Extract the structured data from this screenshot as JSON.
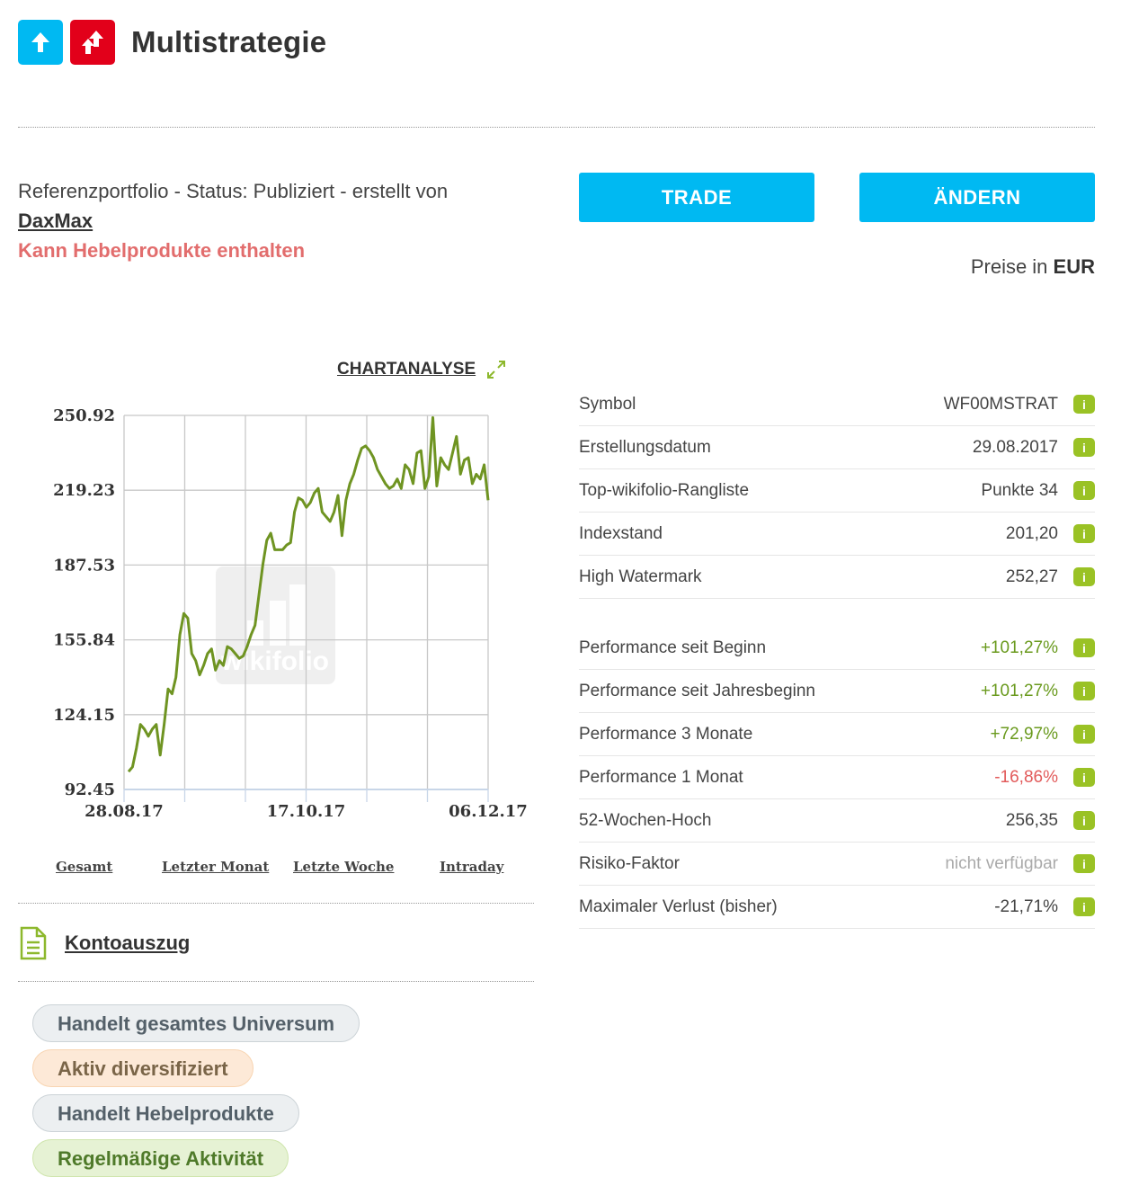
{
  "header": {
    "title": "Multistrategie",
    "badges": [
      {
        "icon": "arrow-up-icon",
        "color": "#00b9f2"
      },
      {
        "icon": "double-arrow-up-icon",
        "color": "#e2001a"
      }
    ]
  },
  "meta": {
    "status_line": "Referenzportfolio - Status: Publiziert - erstellt von",
    "author": "DaxMax",
    "leverage_warning": "Kann Hebelprodukte enthalten"
  },
  "actions": {
    "trade_label": "TRADE",
    "edit_label": "ÄNDERN"
  },
  "prices": {
    "prefix": "Preise in",
    "currency": "EUR"
  },
  "chart_link": {
    "label": "CHARTANALYSE"
  },
  "chart_data": {
    "type": "line",
    "title": "",
    "xlabel": "",
    "ylabel": "",
    "y_ticks": [
      "250.92",
      "219.23",
      "187.53",
      "155.84",
      "124.15",
      "92.45"
    ],
    "x_ticks": [
      "28.08.17",
      "17.10.17",
      "06.12.17"
    ],
    "ylim": [
      92.45,
      250.92
    ],
    "grid": true,
    "color": "#6f9422",
    "watermark": "wikifolio",
    "series": [
      {
        "values": [
          100,
          102,
          110,
          120,
          118,
          115,
          118,
          120,
          107,
          120,
          135,
          133,
          140,
          158,
          167,
          165,
          150,
          147,
          141,
          145,
          150,
          152,
          143,
          147,
          145,
          153,
          152,
          150,
          148,
          149,
          153,
          158,
          162,
          175,
          188,
          198,
          201,
          194,
          194,
          194,
          196,
          197,
          210,
          216,
          215,
          212,
          214,
          218,
          220,
          210,
          208,
          206,
          210,
          217,
          200,
          215,
          222,
          226,
          232,
          237,
          238,
          236,
          233,
          228,
          225,
          222,
          220,
          221,
          224,
          220,
          230,
          228,
          222,
          235,
          236,
          220,
          225,
          250,
          221,
          233,
          230,
          228,
          235,
          242,
          226,
          232,
          233,
          222,
          226,
          224,
          230,
          215
        ]
      }
    ]
  },
  "range_links": [
    "Gesamt",
    "Letzter Monat",
    "Letzte Woche",
    "Intraday"
  ],
  "statement": {
    "label": "Kontoauszug",
    "icon": "document-icon"
  },
  "tags": [
    {
      "label": "Handelt gesamtes Universum",
      "style": "grey"
    },
    {
      "label": "Aktiv diversifiziert",
      "style": "orange"
    },
    {
      "label": "Handelt Hebelprodukte",
      "style": "grey"
    },
    {
      "label": "Regelmäßige Aktivität",
      "style": "green"
    }
  ],
  "key_facts": [
    {
      "label": "Symbol",
      "value": "WF00MSTRAT",
      "tone": "normal"
    },
    {
      "label": "Erstellungsdatum",
      "value": "29.08.2017",
      "tone": "normal"
    },
    {
      "label": "Top-wikifolio-Rangliste",
      "value": "Punkte 34",
      "tone": "normal"
    },
    {
      "label": "Indexstand",
      "value": "201,20",
      "tone": "normal"
    },
    {
      "label": "High Watermark",
      "value": "252,27",
      "tone": "normal"
    }
  ],
  "performance": [
    {
      "label": "Performance seit Beginn",
      "value": "+101,27%",
      "tone": "pos"
    },
    {
      "label": "Performance seit Jahresbeginn",
      "value": "+101,27%",
      "tone": "pos"
    },
    {
      "label": "Performance 3 Monate",
      "value": "+72,97%",
      "tone": "pos"
    },
    {
      "label": "Performance 1 Monat",
      "value": "-16,86%",
      "tone": "neg"
    },
    {
      "label": "52-Wochen-Hoch",
      "value": "256,35",
      "tone": "normal"
    },
    {
      "label": "Risiko-Faktor",
      "value": "nicht verfügbar",
      "tone": "na"
    },
    {
      "label": "Maximaler Verlust (bisher)",
      "value": "-21,71%",
      "tone": "normal"
    }
  ],
  "info_icon_label": "i"
}
